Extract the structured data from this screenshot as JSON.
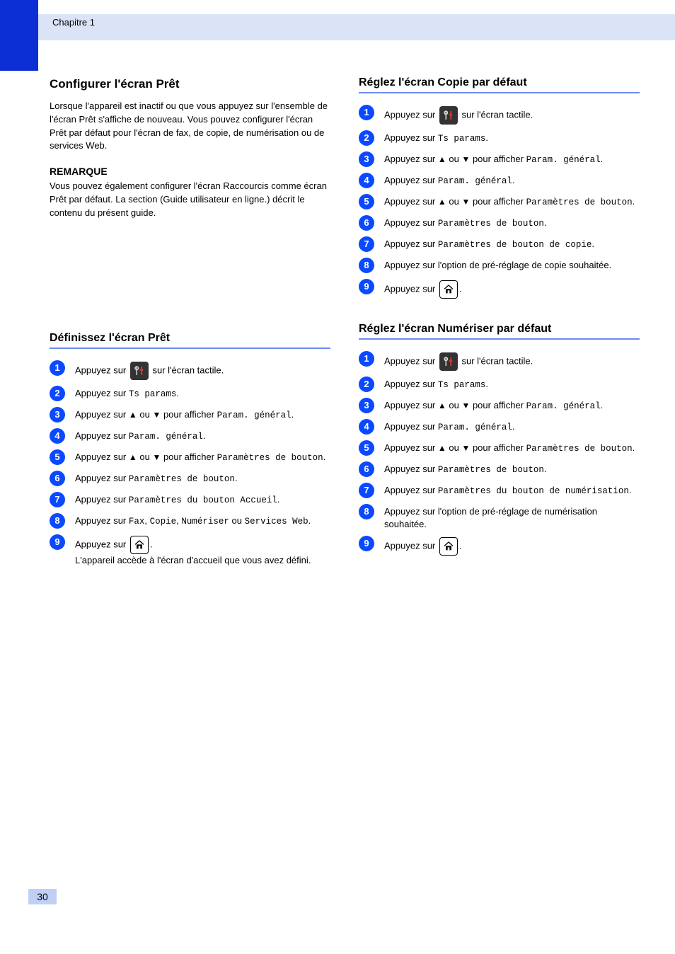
{
  "chapter_label": "Chapitre 1",
  "page_number": "30",
  "icons": {
    "settings": "settings-icon",
    "home": "home-icon",
    "triangle_up": "▲",
    "triangle_down": "▼"
  },
  "left": {
    "heading": "Configurer l'écran Prêt",
    "intro": "Lorsque l'appareil est inactif ou que vous appuyez sur l'ensemble de l'écran Prêt s'affiche de nouveau. Vous pouvez configurer l'écran Prêt par défaut pour l'écran de fax, de copie, de numérisation ou de services Web.",
    "note": {
      "title": "REMARQUE",
      "body": "Vous pouvez également configurer l'écran Raccourcis comme écran Prêt par défaut. La section (Guide utilisateur en ligne.) décrit le contenu du présent guide."
    },
    "section": {
      "title": "Définissez l'écran Prêt",
      "rule": true,
      "steps": [
        {
          "n": 1,
          "pre": "Appuyez sur ",
          "icon": "settings",
          "mid": "sur l'écran tactile."
        },
        {
          "n": 2,
          "pre": "Appuyez sur ",
          "term": "Ts params",
          "post": "."
        },
        {
          "n": 3,
          "pre": "Appuyez sur ",
          "tri": true,
          "mid_after_tri": " pour afficher ",
          "term_after": "Param. général",
          "post": "."
        },
        {
          "n": 4,
          "pre": "Appuyez sur ",
          "term": "Param. général",
          "post": "."
        },
        {
          "n": 5,
          "pre": "Appuyez sur ",
          "tri": true,
          "mid_after_tri": " pour afficher ",
          "term_after": "Paramètres de bouton",
          "post": "."
        },
        {
          "n": 6,
          "pre": "Appuyez sur ",
          "term": "Paramètres de bouton",
          "post": "."
        },
        {
          "n": 7,
          "pre": "Appuyez sur ",
          "term": "Paramètres du bouton Accueil",
          "post": "."
        },
        {
          "n": 8,
          "pre": "Appuyez sur ",
          "term": "Fax",
          "comma": ", ",
          "term2": "Copie",
          "comma2": ", ",
          "term3": "Numériser",
          "or": " ou ",
          "term4": "Services Web",
          "post": "."
        },
        {
          "n": 9,
          "pre": "Appuyez sur ",
          "icon": "home",
          "post": ".",
          "tail": "L'appareil accède à l'écran d'accueil que vous avez défini."
        }
      ]
    }
  },
  "right": {
    "sectionA": {
      "title": "Réglez l'écran Copie par défaut",
      "steps": [
        {
          "n": 1,
          "pre": "Appuyez sur ",
          "icon": "settings",
          "mid": "sur l'écran tactile."
        },
        {
          "n": 2,
          "pre": "Appuyez sur ",
          "term": "Ts params",
          "post": "."
        },
        {
          "n": 3,
          "pre": "Appuyez sur ",
          "tri": true,
          "mid_after_tri": " pour afficher ",
          "term_after": "Param. général",
          "post": "."
        },
        {
          "n": 4,
          "pre": "Appuyez sur ",
          "term": "Param. général",
          "post": "."
        },
        {
          "n": 5,
          "pre": "Appuyez sur ",
          "tri": true,
          "mid_after_tri": " pour afficher ",
          "term_after": "Paramètres de bouton",
          "post": "."
        },
        {
          "n": 6,
          "pre": "Appuyez sur ",
          "term": "Paramètres de bouton",
          "post": "."
        },
        {
          "n": 7,
          "pre": "Appuyez sur ",
          "term": "Paramètres de bouton de copie",
          "post": "."
        },
        {
          "n": 8,
          "pre": "Appuyez sur l'option de pré-réglage de copie souhaitée."
        },
        {
          "n": 9,
          "pre": "Appuyez sur ",
          "icon": "home",
          "post": "."
        }
      ]
    },
    "sectionB": {
      "title": "Réglez l'écran Numériser par défaut",
      "steps": [
        {
          "n": 1,
          "pre": "Appuyez sur ",
          "icon": "settings",
          "mid": "sur l'écran tactile."
        },
        {
          "n": 2,
          "pre": "Appuyez sur ",
          "term": "Ts params",
          "post": "."
        },
        {
          "n": 3,
          "pre": "Appuyez sur ",
          "tri": true,
          "mid_after_tri": " pour afficher ",
          "term_after": "Param. général",
          "post": "."
        },
        {
          "n": 4,
          "pre": "Appuyez sur ",
          "term": "Param. général",
          "post": "."
        },
        {
          "n": 5,
          "pre": "Appuyez sur ",
          "tri": true,
          "mid_after_tri": " pour afficher ",
          "term_after": "Paramètres de bouton",
          "post": "."
        },
        {
          "n": 6,
          "pre": "Appuyez sur ",
          "term": "Paramètres de bouton",
          "post": "."
        },
        {
          "n": 7,
          "pre": "Appuyez sur ",
          "term": "Paramètres du bouton de numérisation",
          "post": "."
        },
        {
          "n": 8,
          "pre": "Appuyez sur l'option de pré-réglage de numérisation souhaitée."
        },
        {
          "n": 9,
          "pre": "Appuyez sur ",
          "icon": "home",
          "post": "."
        }
      ]
    }
  }
}
